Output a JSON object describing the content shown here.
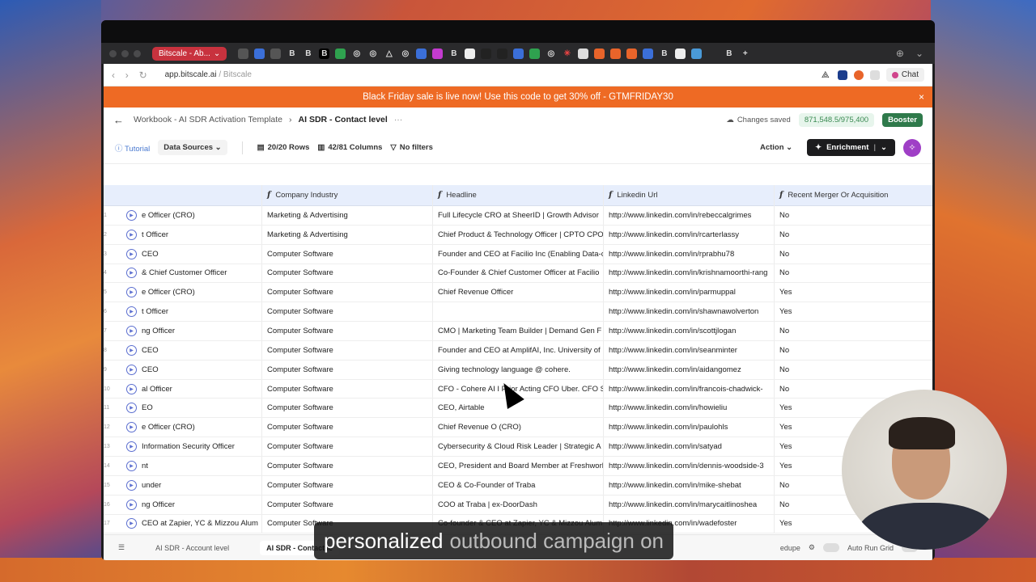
{
  "browser": {
    "active_tab": "Bitscale - Ab...",
    "url_host": "app.bitscale.ai",
    "url_rest": " / Bitscale",
    "chat_label": "Chat"
  },
  "promo": {
    "text": "Black Friday sale is live now! Use this code to get 30% off - GTMFRIDAY30",
    "close": "×"
  },
  "breadcrumb": {
    "workbook": "Workbook - AI SDR Activation Template",
    "sheet": "AI SDR - Contact level",
    "more": "···",
    "saved": "Changes saved",
    "credits": "871,548.5/975,400",
    "booster": "Booster"
  },
  "toolbar": {
    "tutorial": "Tutorial",
    "data_sources": "Data Sources",
    "rows": "20/20 Rows",
    "columns": "42/81 Columns",
    "filters": "No filters",
    "action": "Action",
    "enrichment": "Enrichment"
  },
  "columns": [
    "Company Industry",
    "Headline",
    "Linkedin Url",
    "Recent Merger Or Acquisition"
  ],
  "rows": [
    {
      "n": "1",
      "title": "e Officer (CRO)",
      "industry": "Marketing & Advertising",
      "headline": "Full Lifecycle CRO at SheerID | Growth Advisor",
      "url": "http://www.linkedin.com/in/rebeccalgrimes",
      "merger": "No"
    },
    {
      "n": "2",
      "title": "t Officer",
      "industry": "Marketing & Advertising",
      "headline": "Chief Product & Technology Officer | CPTO CPO",
      "url": "http://www.linkedin.com/in/rcarterlassy",
      "merger": "No"
    },
    {
      "n": "3",
      "title": "CEO",
      "industry": "Computer Software",
      "headline": "Founder and CEO at Facilio Inc (Enabling Data-c",
      "url": "http://www.linkedin.com/in/rprabhu78",
      "merger": "No"
    },
    {
      "n": "4",
      "title": "& Chief Customer Officer",
      "industry": "Computer Software",
      "headline": "Co-Founder & Chief Customer Officer at Facilio",
      "url": "http://www.linkedin.com/in/krishnamoorthi-rang",
      "merger": "No"
    },
    {
      "n": "5",
      "title": "e Officer (CRO)",
      "industry": "Computer Software",
      "headline": "Chief Revenue Officer",
      "url": "http://www.linkedin.com/in/parmuppal",
      "merger": "Yes"
    },
    {
      "n": "6",
      "title": "t Officer",
      "industry": "Computer Software",
      "headline": "",
      "url": "http://www.linkedin.com/in/shawnawolverton",
      "merger": "Yes"
    },
    {
      "n": "7",
      "title": "ng Officer",
      "industry": "Computer Software",
      "headline": "CMO | Marketing Team Builder | Demand Gen F",
      "url": "http://www.linkedin.com/in/scottjlogan",
      "merger": "No"
    },
    {
      "n": "8",
      "title": "CEO",
      "industry": "Computer Software",
      "headline": "Founder and CEO at AmplifAI, Inc. University of",
      "url": "http://www.linkedin.com/in/seanminter",
      "merger": "No"
    },
    {
      "n": "9",
      "title": "CEO",
      "industry": "Computer Software",
      "headline": "Giving technology language @ cohere.",
      "url": "http://www.linkedin.com/in/aidangomez",
      "merger": "No"
    },
    {
      "n": "10",
      "title": "al Officer",
      "industry": "Computer Software",
      "headline": "CFO - Cohere AI I Prior Acting CFO Uber. CFO S",
      "url": "http://www.linkedin.com/in/francois-chadwick-",
      "merger": "No"
    },
    {
      "n": "11",
      "title": "EO",
      "industry": "Computer Software",
      "headline": "CEO, Airtable",
      "url": "http://www.linkedin.com/in/howieliu",
      "merger": "Yes"
    },
    {
      "n": "12",
      "title": "e Officer (CRO)",
      "industry": "Computer Software",
      "headline": "Chief Revenue O    (CRO)",
      "url": "http://www.linkedin.com/in/paulohls",
      "merger": "Yes"
    },
    {
      "n": "13",
      "title": "Information Security Officer",
      "industry": "Computer Software",
      "headline": "Cybersecurity & Cloud Risk Leader | Strategic A",
      "url": "http://www.linkedin.com/in/satyad",
      "merger": "Yes"
    },
    {
      "n": "14",
      "title": "nt",
      "industry": "Computer Software",
      "headline": "CEO, President and Board Member at Freshworl",
      "url": "http://www.linkedin.com/in/dennis-woodside-3",
      "merger": "Yes"
    },
    {
      "n": "15",
      "title": "under",
      "industry": "Computer Software",
      "headline": "CEO & Co-Founder of Traba",
      "url": "http://www.linkedin.com/in/mike-shebat",
      "merger": "No"
    },
    {
      "n": "16",
      "title": "ng Officer",
      "industry": "Computer Software",
      "headline": "COO at Traba | ex-DoorDash",
      "url": "http://www.linkedin.com/in/marycaitlinoshea",
      "merger": "No"
    },
    {
      "n": "17",
      "title": "CEO at Zapier, YC & Mizzou Alum",
      "industry": "Computer Software",
      "headline": "Co-founder & CEO at Zapier, YC & Mizzou Alum",
      "url": "http://www.linkedin.com/in/wadefoster",
      "merger": "Yes"
    }
  ],
  "bottom": {
    "tab1": "AI SDR - Account level",
    "tab2": "AI SDR - Contact le",
    "label_fragment": "edupe",
    "auto_run": "Auto Run Grid"
  },
  "subtitle": {
    "highlight": "personalized",
    "rest": "outbound campaign on"
  }
}
